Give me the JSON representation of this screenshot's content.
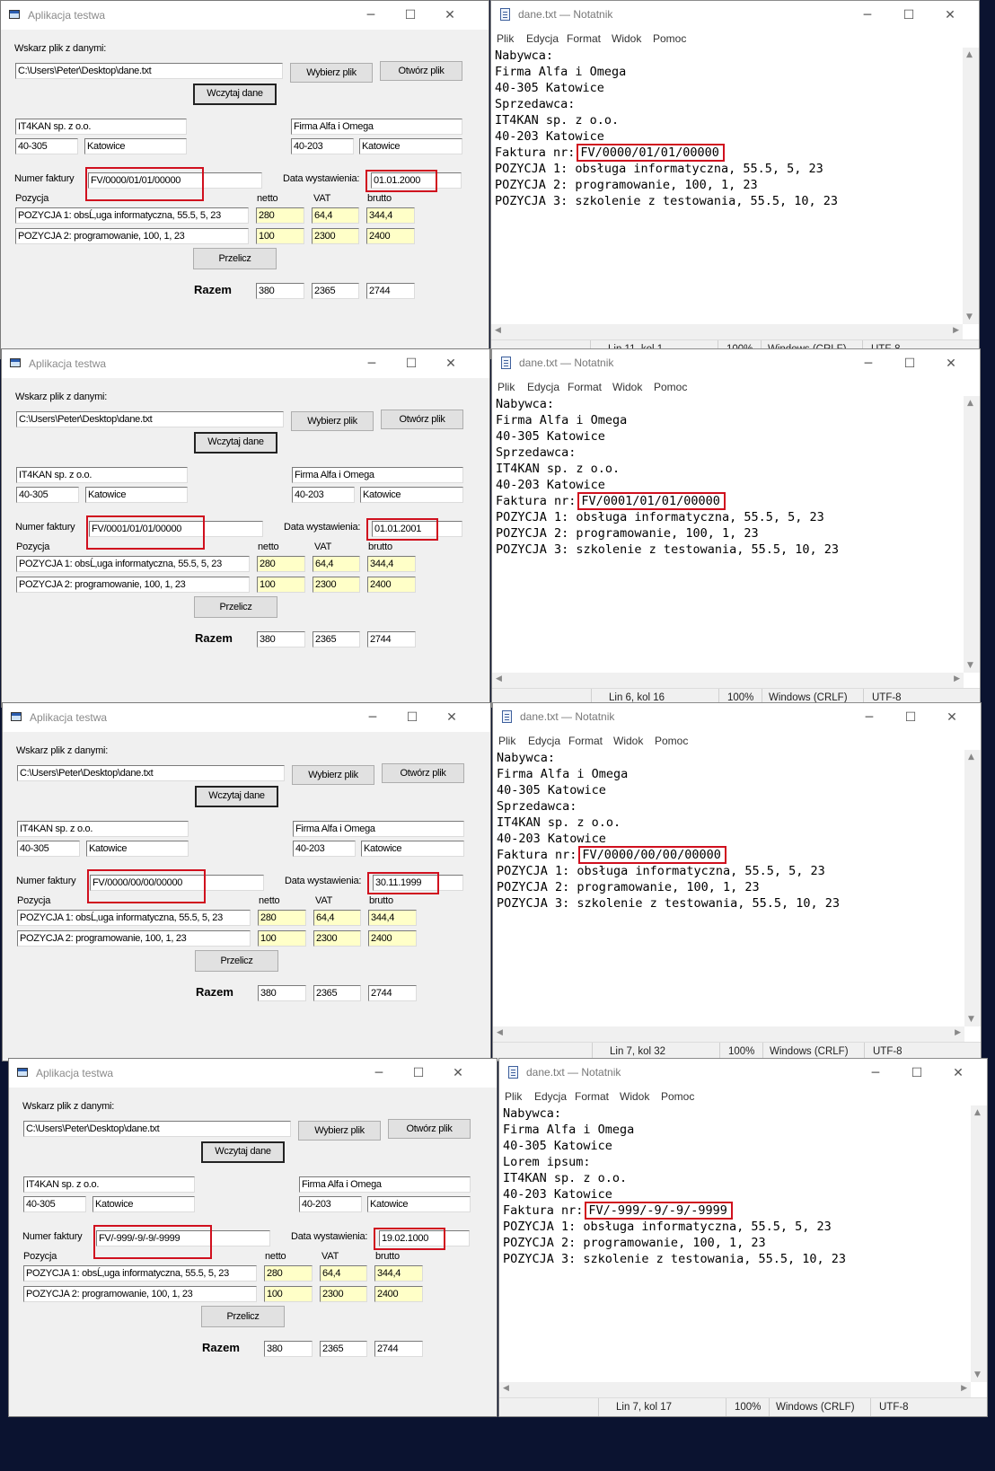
{
  "app": {
    "title": "Aplikacja testwa",
    "file_label": "Wskarz plik z danymi:",
    "file_path": "C:\\Users\\Peter\\Desktop\\dane.txt",
    "btn_choose": "Wybierz plik",
    "btn_open": "Otwórz plik",
    "btn_load": "Wczytaj dane",
    "buyer_name": "IT4KAN sp. z o.o.",
    "buyer_zip": "40-305",
    "buyer_city": "Katowice",
    "seller_name": "Firma Alfa i Omega",
    "seller_zip": "40-203",
    "seller_city": "Katowice",
    "invoice_label": "Numer faktury",
    "date_label": "Data wystawienia:",
    "col_position": "Pozycja",
    "col_net": "netto",
    "col_vat": "VAT",
    "col_gross": "brutto",
    "item1": "POZYCJA 1: obsĹ‚uga informatyczna, 55.5, 5, 23",
    "item1_net": "280",
    "item1_vat": "64,4",
    "item1_gross": "344,4",
    "item2": "POZYCJA 2: programowanie, 100, 1, 23",
    "item2_net": "100",
    "item2_vat": "2300",
    "item2_gross": "2400",
    "btn_calc": "Przelicz",
    "total_label": "Razem",
    "total_net": "380",
    "total_vat": "2365",
    "total_gross": "2744"
  },
  "notepad": {
    "title": "dane.txt — Notatnik",
    "menu": [
      "Plik",
      "Edycja",
      "Format",
      "Widok",
      "Pomoc"
    ],
    "zoom": "100%",
    "eol": "Windows (CRLF)",
    "encoding": "UTF-8",
    "lines": {
      "nabywca": "Nabywca:",
      "firma": "Firma Alfa i Omega",
      "addr1": "40-305 Katowice",
      "lorem": "Lorem ipsum:",
      "sprzedawca": "Sprzedawca:",
      "it4kan": "IT4KAN sp. z o.o.",
      "addr2": "40-203 Katowice",
      "faktura": "Faktura nr:",
      "poz1": "POZYCJA 1: obsługa informatyczna, 55.5, 5, 23",
      "poz2": "POZYCJA 2: programowanie, 100, 1, 23",
      "poz3": "POZYCJA 3: szkolenie z testowania, 55.5, 10, 23"
    }
  },
  "panels": [
    {
      "invoice": "FV/0000/01/01/00000",
      "date": "01.01.2000",
      "cursor": "Lin 11, kol 1"
    },
    {
      "invoice": "FV/0001/01/01/00000",
      "date": "01.01.2001",
      "cursor": "Lin 6, kol 16"
    },
    {
      "invoice": "FV/0000/00/00/00000",
      "date": "30.11.1999",
      "cursor": "Lin 7, kol 32"
    },
    {
      "invoice": "FV/-999/-9/-9/-9999",
      "date": "19.02.1000",
      "cursor": "Lin 7, kol 17"
    }
  ]
}
